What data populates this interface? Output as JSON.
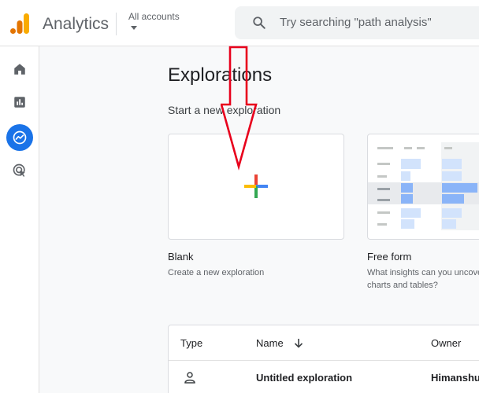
{
  "header": {
    "app_name": "Analytics",
    "account_label": "All accounts",
    "search_placeholder": "Try searching \"path analysis\""
  },
  "sidebar": {
    "items": [
      {
        "name": "home",
        "icon": "home-icon"
      },
      {
        "name": "reports",
        "icon": "reports-icon"
      },
      {
        "name": "explore",
        "icon": "explore-icon",
        "active": true
      },
      {
        "name": "advertising",
        "icon": "advertising-icon"
      }
    ]
  },
  "main": {
    "title": "Explorations",
    "subtitle": "Start a new exploration",
    "templates": [
      {
        "name": "Blank",
        "desc": "Create a new exploration"
      },
      {
        "name": "Free form",
        "desc_line1": "What insights can you uncove",
        "desc_line2": "charts and tables?"
      }
    ],
    "table": {
      "headers": {
        "type": "Type",
        "name": "Name",
        "owner": "Owner"
      },
      "rows": [
        {
          "name": "Untitled exploration",
          "owner": "Himanshu"
        }
      ]
    }
  },
  "colors": {
    "accent": "#1a73e8",
    "annotation": "#e8001c",
    "logo_orange": "#f9ab00",
    "logo_dark": "#e37400"
  }
}
